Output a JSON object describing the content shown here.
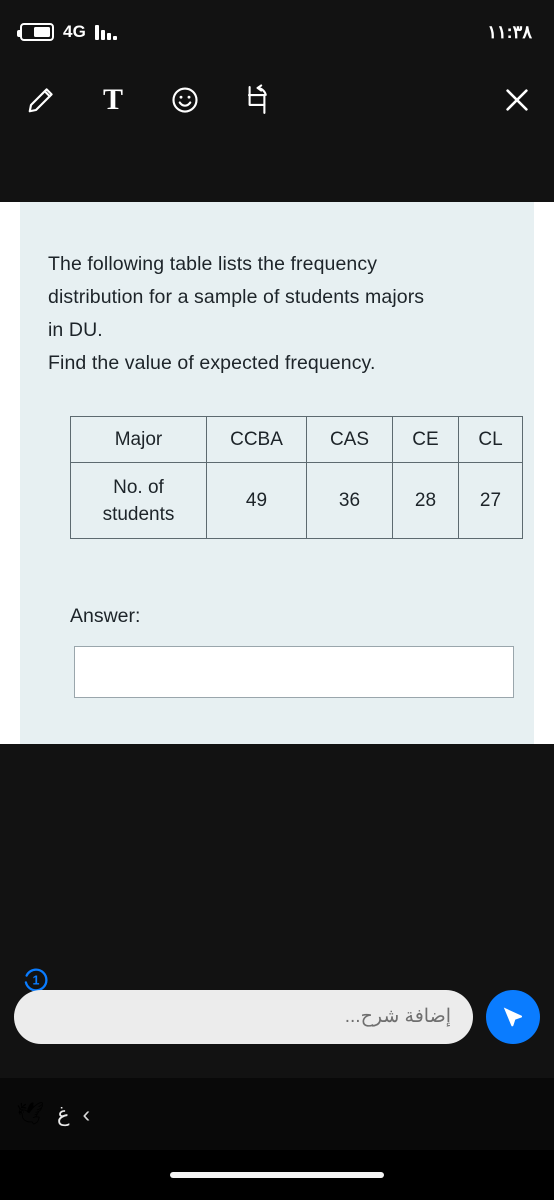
{
  "status_bar": {
    "network_label": "4G",
    "time": "١١:٣٨",
    "battery_level_percent": 62,
    "signal_bars": 4,
    "icons": [
      "battery-icon",
      "signal-bars-icon"
    ]
  },
  "editor_toolbar": {
    "tools": [
      {
        "name": "draw-tool",
        "icon": "pencil-icon",
        "label": "Draw"
      },
      {
        "name": "text-tool",
        "icon": "text-t-icon",
        "label": "T"
      },
      {
        "name": "sticker-tool",
        "icon": "smiley-face-icon",
        "label": "Sticker"
      },
      {
        "name": "crop-rotate-tool",
        "icon": "crop-rotate-icon",
        "label": "Crop"
      }
    ],
    "close": {
      "name": "close-button",
      "icon": "close-x-icon",
      "label": "Close"
    }
  },
  "attachment": {
    "question": {
      "line1": "The following table lists the frequency",
      "line2": "distribution for a sample of students majors",
      "line3": "in DU.",
      "line4": "Find the value of expected frequency."
    },
    "table": {
      "headers": [
        "Major",
        "CCBA",
        "CAS",
        "CE",
        "CL"
      ],
      "row_label": "No. of students",
      "row_label_line1": "No. of",
      "row_label_line2": "students",
      "values": [
        "49",
        "36",
        "28",
        "27"
      ]
    },
    "answer": {
      "label": "Answer:",
      "value": "",
      "placeholder": ""
    },
    "card_bg_color": "#e7f0f2"
  },
  "comment_bar": {
    "badge_count": "1",
    "badge_color": "#0a7cff",
    "placeholder": "إضافة شرح...",
    "value": "",
    "send_button_label": "إرسال",
    "send_icon": "send-arrow-icon"
  },
  "bottom_nav": {
    "items": [
      {
        "name": "dove-emoji",
        "glyph": "🕊"
      },
      {
        "name": "arabic-letter-glyph",
        "glyph": "غ"
      },
      {
        "name": "back-chevron-icon",
        "glyph": "‹"
      }
    ]
  },
  "home_indicator": {
    "name": "home-indicator"
  }
}
